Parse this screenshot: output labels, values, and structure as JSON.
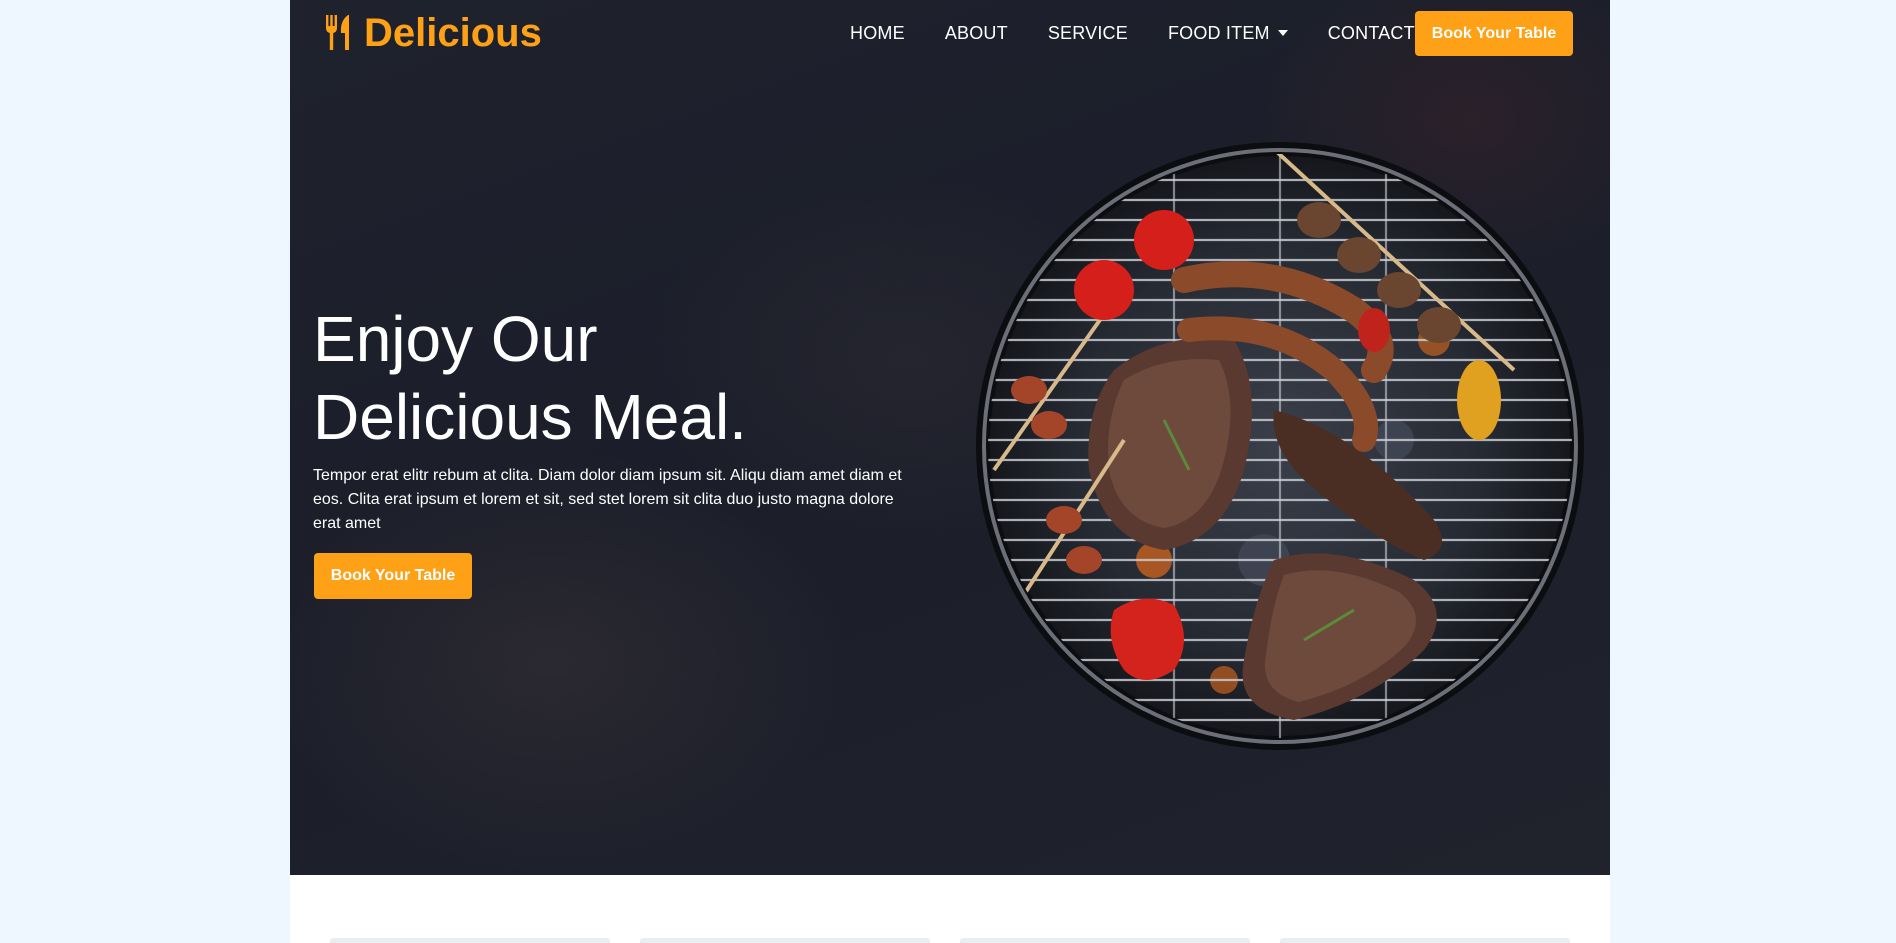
{
  "brand": {
    "name": "Delicious",
    "icon": "utensils-icon",
    "color": "#FEA116"
  },
  "nav": {
    "items": [
      {
        "label": "HOME"
      },
      {
        "label": "ABOUT"
      },
      {
        "label": "SERVICE"
      },
      {
        "label": "FOOD ITEM",
        "has_dropdown": true
      },
      {
        "label": "CONTACT"
      }
    ],
    "cta_label": "Book Your Table"
  },
  "hero": {
    "title_line1": "Enjoy Our",
    "title_line2": "Delicious Meal.",
    "description": "Tempor erat elitr rebum at clita. Diam dolor diam ipsum sit. Aliqu diam amet diam et eos. Clita erat ipsum et lorem et sit, sed stet lorem sit clita duo justo magna dolore erat amet",
    "cta_label": "Book Your Table",
    "image": "bbq-grill-image"
  },
  "colors": {
    "accent": "#FEA116",
    "hero_bg": "#1f222d",
    "page_bg": "#eef6ff"
  }
}
